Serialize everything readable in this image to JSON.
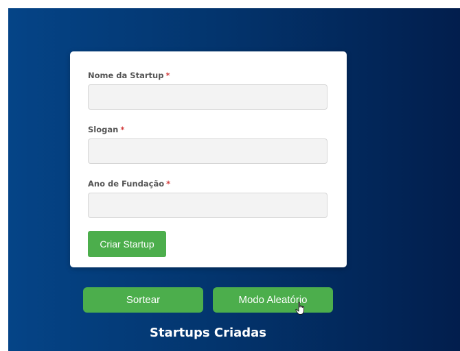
{
  "form": {
    "fields": [
      {
        "label": "Nome da Startup",
        "required_mark": "*",
        "value": ""
      },
      {
        "label": "Slogan",
        "required_mark": "*",
        "value": ""
      },
      {
        "label": "Ano de Fundação",
        "required_mark": "*",
        "value": ""
      }
    ],
    "submit_label": "Criar Startup"
  },
  "actions": {
    "draw_label": "Sortear",
    "random_mode_label": "Modo Aleatório"
  },
  "section": {
    "title": "Startups Criadas"
  },
  "colors": {
    "background_start": "#054487",
    "background_end": "#021e4d",
    "button_green": "#4cae4c",
    "required_red": "#d23b3b"
  },
  "icons": {
    "cursor": "hand-pointer-icon"
  }
}
